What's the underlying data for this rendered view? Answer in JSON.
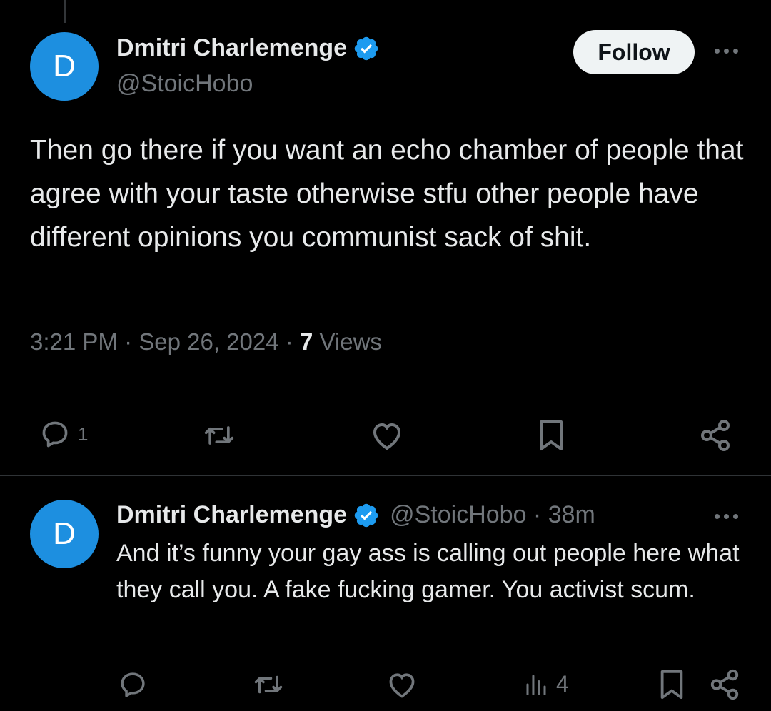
{
  "main_tweet": {
    "avatar_letter": "D",
    "display_name": "Dmitri Charlemenge",
    "handle": "@StoicHobo",
    "follow_label": "Follow",
    "text": "Then go there if you want an echo chamber of people that agree with your taste otherwise stfu other people have different opinions you communist sack of shit.",
    "time": "3:21 PM",
    "date": "Sep 26, 2024",
    "views_count": "7",
    "views_label": "Views",
    "reply_count": "1",
    "separator": "·"
  },
  "reply_tweet": {
    "avatar_letter": "D",
    "display_name": "Dmitri Charlemenge",
    "handle_time": "@StoicHobo · 38m",
    "text": "And it’s funny your gay ass is calling out people here what they call you. A fake fucking gamer. You activist scum.",
    "views_count": "4"
  },
  "colors": {
    "background": "#000000",
    "text_primary": "#e7e9ea",
    "text_secondary": "#71767b",
    "verified_blue": "#1d9bf0",
    "avatar_blue": "#1d8fe0",
    "follow_bg": "#eff3f4"
  },
  "icons": [
    "verified-badge-icon",
    "more-icon",
    "reply-icon",
    "retweet-icon",
    "like-icon",
    "bookmark-icon",
    "share-icon",
    "views-icon"
  ]
}
